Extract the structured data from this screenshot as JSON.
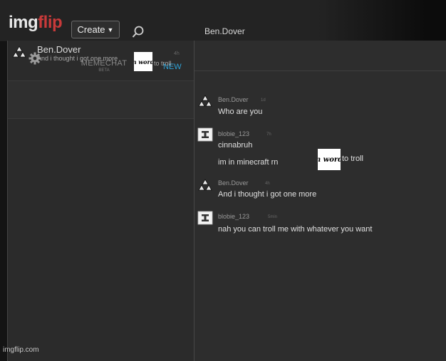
{
  "nav": {
    "logo_part1": "img",
    "logo_part2": "flip",
    "create_label": "Create",
    "search_icon": "search-icon"
  },
  "sidebar": {
    "settings_icon": "gear-icon",
    "title": "MEMECHAT",
    "subtitle": "BETA",
    "new_label": "NEW",
    "conversations": [
      {
        "name": "Ben.Dover",
        "time": "4h",
        "preview": "And i thought i got one more",
        "sticker": "n word",
        "suffix": "to troll"
      }
    ]
  },
  "chat": {
    "title": "Ben.Dover",
    "messages": [
      {
        "user": "Ben.Dover",
        "time": "1d",
        "lines": [
          "Who are you"
        ]
      },
      {
        "user": "blobie_123",
        "time": "7h",
        "lines": [
          "cinnabruh",
          "im in minecraft rn"
        ]
      },
      {
        "user": "Ben.Dover",
        "time": "4h",
        "lines": [
          "And i thought i got one more"
        ],
        "sticker": "n word",
        "suffix": "to troll"
      },
      {
        "user": "blobie_123",
        "time": "5min",
        "lines": [
          "nah you can troll me with whatever you want"
        ]
      }
    ]
  },
  "watermark": "imgflip.com",
  "colors": {
    "accent_blue": "#2ea3d8",
    "logo_red": "#c83a3a",
    "panel_bg": "#2d2d2d"
  }
}
